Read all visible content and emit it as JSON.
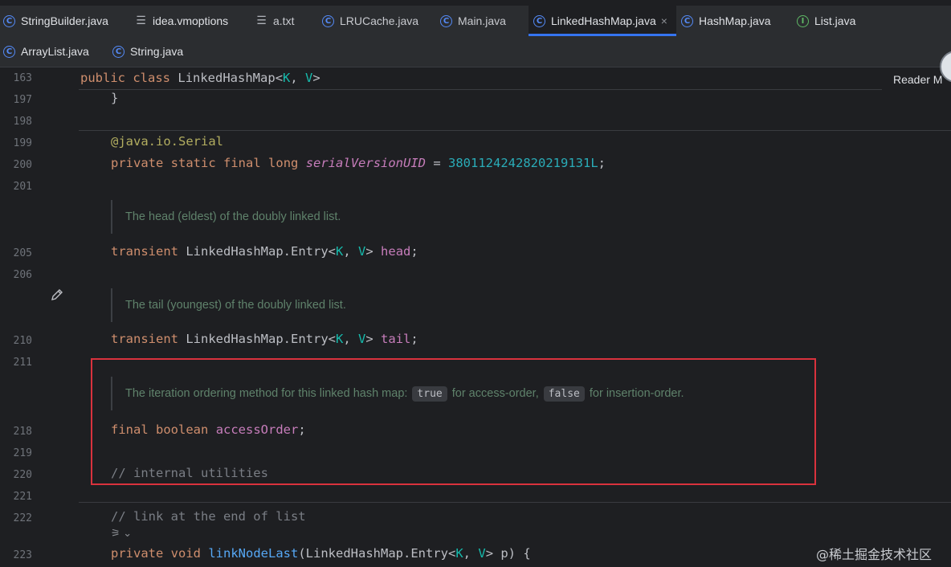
{
  "tabs_row1": [
    {
      "label": "StringBuilder.java",
      "icon": "class-icon",
      "active": false
    },
    {
      "label": "idea.vmoptions",
      "icon": "text-file-icon",
      "active": false
    },
    {
      "label": "a.txt",
      "icon": "text-file-icon",
      "active": false
    },
    {
      "label": "LRUCache.java",
      "icon": "class-icon",
      "active": false
    },
    {
      "label": "Main.java",
      "icon": "class-icon",
      "active": false
    },
    {
      "label": "LinkedHashMap.java",
      "icon": "class-icon",
      "active": true,
      "close": "×"
    },
    {
      "label": "HashMap.java",
      "icon": "class-icon",
      "active": false
    },
    {
      "label": "List.java",
      "icon": "interface-icon",
      "active": false
    }
  ],
  "tabs_row2": [
    {
      "label": "ArrayList.java",
      "icon": "class-icon"
    },
    {
      "label": "String.java",
      "icon": "class-icon"
    }
  ],
  "reader_mode": "Reader M",
  "sticky": {
    "line": "163",
    "kw1": "public",
    "kw2": "class",
    "name": "LinkedHashMap",
    "lt": "<",
    "k": "K",
    ",": ", ",
    "v": "V",
    "gt": ">"
  },
  "lines": {
    "l197": "197",
    "l198": "198",
    "l199": "199",
    "l200": "200",
    "l201": "201",
    "l205": "205",
    "l206": "206",
    "l210": "210",
    "l211": "211",
    "l218": "218",
    "l219": "219",
    "l220": "220",
    "l221": "221",
    "l222": "222",
    "l223": "223"
  },
  "code": {
    "brace": "}",
    "annotation": "@java.io.Serial",
    "mod_private": "private",
    "mod_static": "static",
    "mod_final": "final",
    "type_long": "long",
    "serial_name": "serialVersionUID",
    "eq": " = ",
    "serial_value": "3801124242820219131L",
    "semi": ";",
    "transient": "transient",
    "entry_type": "LinkedHashMap.Entry",
    "K": "K",
    "V": "V",
    "head": "head",
    "tail": "tail",
    "final": "final",
    "boolean": "boolean",
    "accessOrder": "accessOrder",
    "comment_internal": "// internal utilities",
    "comment_link": "// link at the end of list",
    "void": "void",
    "linkNodeLast": "linkNodeLast",
    "param_tail": "> p) {"
  },
  "docs": {
    "head": "The head (eldest) of the doubly linked list.",
    "tail": "The tail (youngest) of the doubly linked list.",
    "order_pre": "The iteration ordering method for this linked hash map:",
    "order_true": "true",
    "order_mid": "for access-order,",
    "order_false": "false",
    "order_post": "for insertion-order."
  },
  "inlay": "⚞ ⌄",
  "watermark": "@稀土掘金技术社区",
  "colors": {
    "highlight": "#d9323d",
    "accent": "#3574f0"
  }
}
